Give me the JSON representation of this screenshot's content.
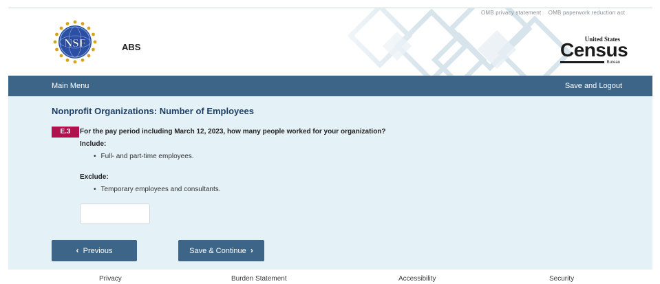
{
  "utility_links": [
    "OMB privacy statement",
    "OMB paperwork reduction act"
  ],
  "header": {
    "app_name": "ABS",
    "nsf_logo_text": "NSF",
    "census_logo": {
      "top": "United States",
      "main": "Census",
      "bottom": "Bureau"
    }
  },
  "nav": {
    "main_menu": "Main Menu",
    "save_logout": "Save and Logout"
  },
  "page": {
    "title": "Nonprofit Organizations: Number of Employees",
    "question_id": "E.3",
    "question_text": "For the pay period including March 12, 2023, how many people worked for your organization?",
    "include_label": "Include:",
    "include_items": [
      "Full- and part-time employees."
    ],
    "exclude_label": "Exclude:",
    "exclude_items": [
      "Temporary employees and consultants."
    ],
    "answer_value": ""
  },
  "buttons": {
    "previous": "Previous",
    "save_continue": "Save & Continue"
  },
  "footer": {
    "links": [
      "Privacy",
      "Burden Statement",
      "Accessibility",
      "Security"
    ]
  },
  "colors": {
    "nav_bar": "#3d6587",
    "badge": "#b0124e",
    "panel": "#e4f2f8",
    "title": "#1c3f63"
  }
}
